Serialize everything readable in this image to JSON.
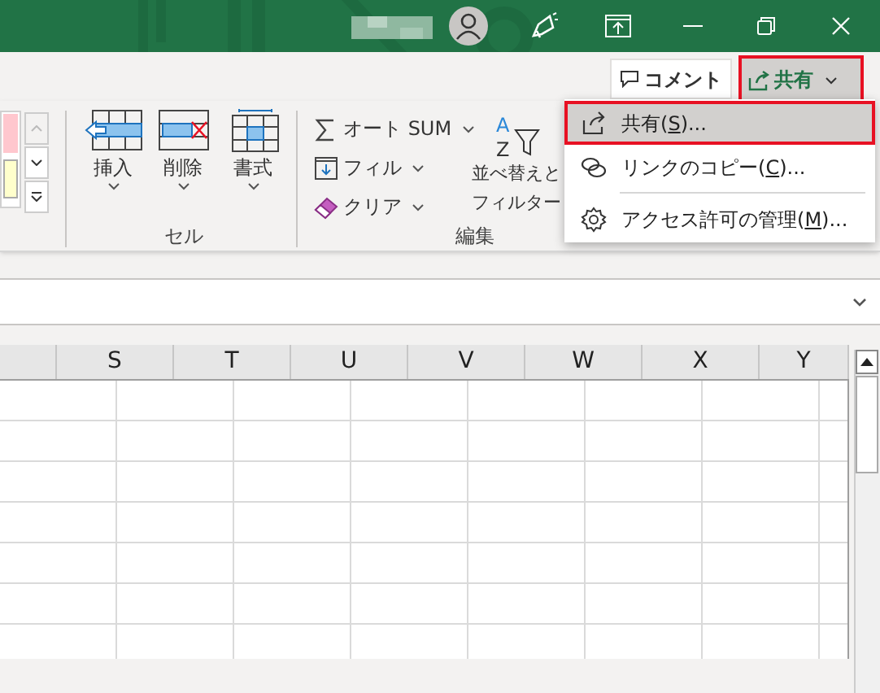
{
  "ribbon_top": {
    "comment_button": "コメント",
    "share_button": {
      "label": "共有",
      "selected": true
    }
  },
  "cells_group": {
    "label": "セル",
    "commands": [
      {
        "kind": "insert",
        "label": "挿入"
      },
      {
        "kind": "delete",
        "label": "削除"
      },
      {
        "kind": "format",
        "label": "書式"
      }
    ]
  },
  "editing_group": {
    "label": "編集",
    "commands": [
      {
        "kind": "sum",
        "label": "オート SUM"
      },
      {
        "kind": "fill",
        "label": "フィル"
      },
      {
        "kind": "clear",
        "label": "クリア"
      }
    ],
    "sort_icon_letters": [
      "A",
      "Z"
    ],
    "sort_filter": [
      "並べ替えと",
      "フィルター"
    ]
  },
  "share_menu": [
    {
      "kind": "share",
      "before": "共有(",
      "key": "S",
      "after": ")...",
      "selected": true
    },
    {
      "kind": "link",
      "before": "リンクのコピー(",
      "key": "C",
      "after": ")...",
      "selected": false
    },
    {
      "kind": "access",
      "before": "アクセス許可の管理(",
      "key": "M",
      "after": ")...",
      "selected": false
    }
  ],
  "sheet": {
    "columns": [
      "S",
      "T",
      "U",
      "V",
      "W",
      "X",
      "Y"
    ]
  }
}
